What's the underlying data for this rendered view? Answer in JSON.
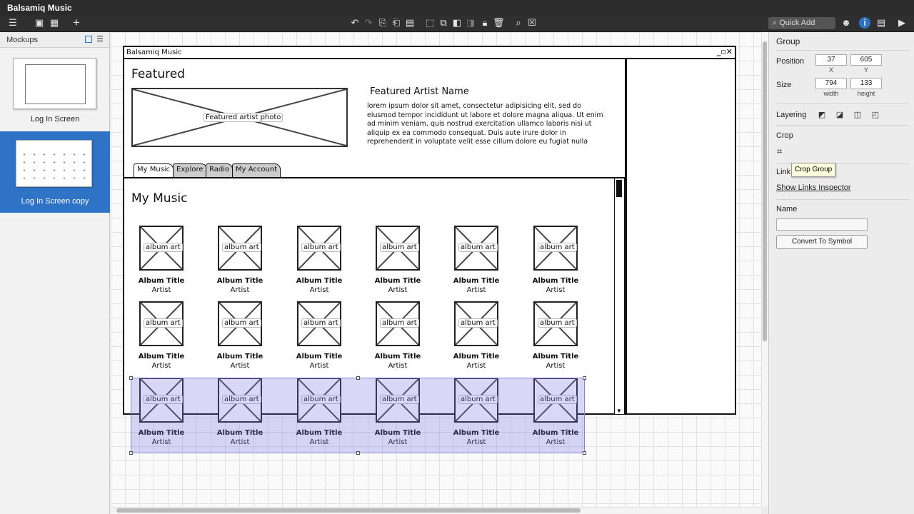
{
  "app": {
    "title": "Balsamiq Music",
    "quick_add": "Quick Add"
  },
  "mockups_panel": {
    "header": "Mockups",
    "items": [
      {
        "label": "Log In Screen",
        "selected": false
      },
      {
        "label": "Log In Screen copy",
        "selected": true
      }
    ]
  },
  "mockup": {
    "window_title": "Balsamiq Music",
    "featured_heading": "Featured",
    "photo_label": "Featured artist photo",
    "artist_name": "Featured Artist Name",
    "lorem": "lorem ipsum dolor sit amet, consectetur adipisicing elit, sed do eiusmod tempor incididunt ut labore et dolore magna aliqua. Ut enim ad minim veniam, quis nostrud exercitation ullamco laboris nisi ut aliquip ex ea commodo consequat. Duis aute irure dolor in reprehenderit in voluptate velit esse cillum dolore eu fugiat nulla pariatur. Excepteur sint",
    "tabs": [
      "My Music",
      "Explore",
      "Radio",
      "My Account"
    ],
    "panel_heading": "My Music",
    "album_label": "album art",
    "album_title": "Album Title",
    "album_artist": "Artist"
  },
  "inspector": {
    "title": "Group",
    "position_label": "Position",
    "x": "37",
    "y": "605",
    "x_label": "X",
    "y_label": "Y",
    "size_label": "Size",
    "width": "794",
    "height": "133",
    "width_label": "width",
    "height_label": "height",
    "layering_label": "Layering",
    "crop_label": "Crop",
    "links_label": "Link",
    "tooltip": "Crop Group",
    "show_links": "Show Links Inspector",
    "name_label": "Name",
    "name_value": "",
    "convert_button": "Convert To Symbol"
  }
}
